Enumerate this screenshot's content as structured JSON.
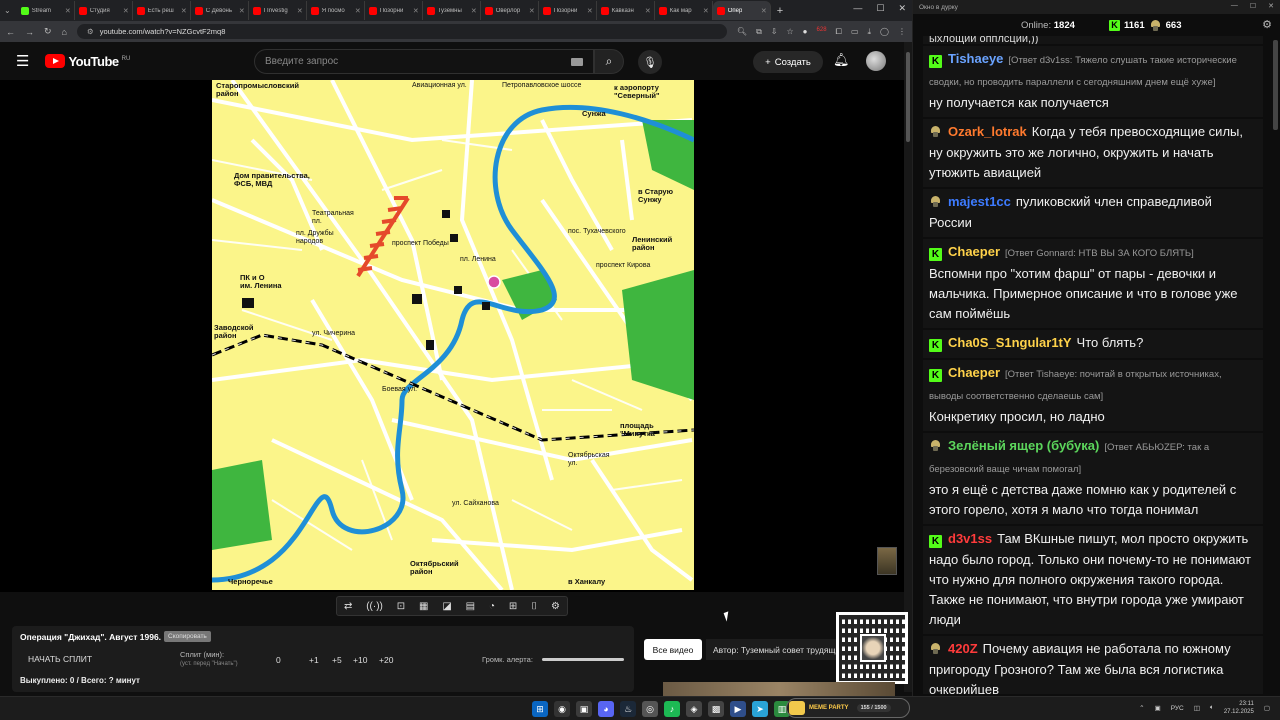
{
  "browser": {
    "tabs": [
      {
        "label": "Stream",
        "color": "#53fc18",
        "active": false
      },
      {
        "label": "Студия",
        "color": "#ff0000",
        "active": false
      },
      {
        "label": "Есть реш",
        "color": "#ff0000",
        "active": false
      },
      {
        "label": "С Девонь",
        "color": "#ff0000",
        "active": false
      },
      {
        "label": "I Investig",
        "color": "#ff0000",
        "active": false
      },
      {
        "label": "Я посмо",
        "color": "#ff0000",
        "active": false
      },
      {
        "label": "Позорни",
        "color": "#ff0000",
        "active": false
      },
      {
        "label": "Туземны",
        "color": "#ff0000",
        "active": false
      },
      {
        "label": "Оверлор",
        "color": "#ff0000",
        "active": false
      },
      {
        "label": "Позорни",
        "color": "#ff0000",
        "active": false
      },
      {
        "label": "Кавказн",
        "color": "#ff0000",
        "active": false
      },
      {
        "label": "Как мар",
        "color": "#ff0000",
        "active": false
      },
      {
        "label": "Опер",
        "color": "#ff0000",
        "active": true
      }
    ],
    "url": "youtube.com/watch?v=NZGcvtF2mq8",
    "ext_badge": "628"
  },
  "youtube": {
    "logo_text": "YouTube",
    "region": "RU",
    "search_placeholder": "Введите запрос",
    "create_label": "Создать"
  },
  "map": {
    "labels": [
      {
        "text": "Старопромысловский\nрайон",
        "kind": "b"
      },
      {
        "text": "Авиационная ул.",
        "kind": "s"
      },
      {
        "text": "Петропавловское шоссе",
        "kind": "s"
      },
      {
        "text": "к аэропорту\n\"Северный\"",
        "kind": "b"
      },
      {
        "text": "Сунжа",
        "kind": "b"
      },
      {
        "text": "Дом правительства,\nФСБ, МВД",
        "kind": "b"
      },
      {
        "text": "в Старую\nСунжу",
        "kind": "b"
      },
      {
        "text": "Театральная\nпл.",
        "kind": "s"
      },
      {
        "text": "пл. Дружбы\nнародов",
        "kind": "s"
      },
      {
        "text": "пос. Тухачевского",
        "kind": "s"
      },
      {
        "text": "Ленинский\nрайон",
        "kind": "b"
      },
      {
        "text": "проспект Кирова",
        "kind": "s"
      },
      {
        "text": "ПК и О\nим. Ленина",
        "kind": "b"
      },
      {
        "text": "Заводской\nрайон",
        "kind": "b"
      },
      {
        "text": "ул. Чичерина",
        "kind": "s"
      },
      {
        "text": "Боевая ул.",
        "kind": "s"
      },
      {
        "text": "площадь\n\"Минутка\"",
        "kind": "b"
      },
      {
        "text": "Октябрьская\nул.",
        "kind": "s"
      },
      {
        "text": "ул. Сайханова",
        "kind": "s"
      },
      {
        "text": "Октябрьский\nрайон",
        "kind": "b"
      },
      {
        "text": "Черноречье",
        "kind": "b"
      },
      {
        "text": "в Ханкалу",
        "kind": "b"
      },
      {
        "text": "проспект Победы",
        "kind": "s"
      },
      {
        "text": "пл. Ленина",
        "kind": "s"
      }
    ]
  },
  "panel": {
    "title": "Операция \"Джихад\". Август 1996.",
    "badge": "Скопировать",
    "start_split": "НАЧАТЬ СПЛИТ",
    "split_label": "Сплит (мин):",
    "split_sub": "(уст. перед \"Начать\")",
    "split_values": [
      "0",
      "+1",
      "+5",
      "+10",
      "+20"
    ],
    "volume_label": "Громк. алерта:",
    "footer": "Выкуплено: 0 / Всего: ? минут",
    "all_videos": "Все видео",
    "author": "Автор: Туземный совет трудящихся"
  },
  "chat": {
    "window_title": "Окно в дурку",
    "online_label": "Online:",
    "online_count": "1824",
    "kick_count": "1161",
    "twitch_count": "663",
    "messages": [
      {
        "badge": "none",
        "user": "",
        "color": "#ffffff",
        "reply": "",
        "text": "ыхлощии опплсции,))"
      },
      {
        "badge": "kick",
        "user": "Tishaeye",
        "color": "#6aa3ff",
        "reply": "[Ответ d3v1ss: Тяжело слушать такие исторические сводки, но проводить параллели с сегодняшним днем ещё хуже]",
        "text": "ну получается как получается"
      },
      {
        "badge": "twitch",
        "user": "Ozark_lotrak",
        "color": "#ff7a2e",
        "reply": "",
        "text": "Когда у тебя превосходящие силы, ну окружить это же логично, окружить и начать утюжить авиацией"
      },
      {
        "badge": "twitch",
        "user": "majest1cc",
        "color": "#3d7bff",
        "reply": "",
        "text": "пуликовский член справедливой России"
      },
      {
        "badge": "kick",
        "user": "Chaeper",
        "color": "#ffd24a",
        "reply": "[Ответ Gonnard: НТВ ВЫ ЗА КОГО БЛЯТЬ]",
        "text": "Вспомни про \"хотим фарш\" от пары - девочки и мальчика. Примерное описание и что в голове уже сам поймёшь"
      },
      {
        "badge": "kick",
        "user": "Cha0S_S1ngular1tY",
        "color": "#ffd24a",
        "reply": "",
        "text": "Что блять?"
      },
      {
        "badge": "kick",
        "user": "Chaeper",
        "color": "#ffd24a",
        "reply": "[Ответ Tishaeye: почитай в открытых источниках, выводы соответственно сделаешь сам]",
        "text": "Конкретику просил, но ладно"
      },
      {
        "badge": "twitch",
        "user": "Зелёный ящер (бубука)",
        "color": "#5cd65c",
        "reply": "[Ответ АБЬЮZЕР: так а березовский ваще чичам помогал]",
        "text": "это я ещё с детства даже помню как у родителей с этого горело, хотя я мало что тогда понимал"
      },
      {
        "badge": "kick",
        "user": "d3v1ss",
        "color": "#ff3b3b",
        "reply": "",
        "text": "Там ВКшные пишут, мол просто окружить надо было город. Только они почему-то не понимают что нужно для полного окружения такого города. Также не понимают, что внутри города уже умирают люди"
      },
      {
        "badge": "twitch",
        "user": "420Z",
        "color": "#ff3b3b",
        "reply": "",
        "text": "Почему авиация не работала по южному пригороду Грозного? Там же была вся логистика очкерийцев"
      }
    ]
  },
  "taskbar": {
    "meme_label": "MEME PARTY",
    "meme_count": "155 / 1500",
    "lang": "РУС",
    "time": "23:11",
    "date": "27.12.2025"
  }
}
